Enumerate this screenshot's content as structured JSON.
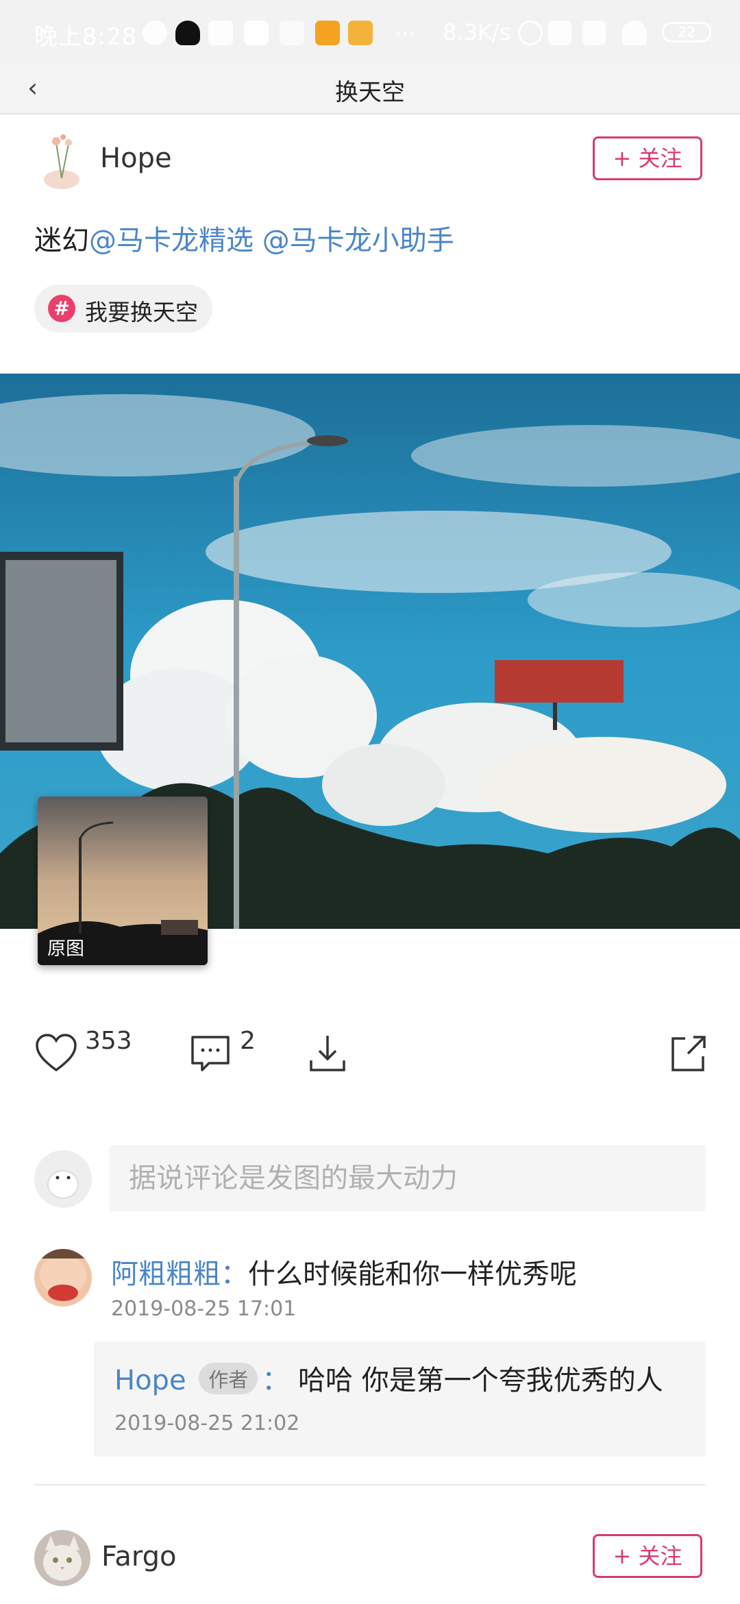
{
  "status_bar": {
    "time": "晚上8:28",
    "speed": "8.3K/s",
    "battery": "22"
  },
  "nav": {
    "back_glyph": "‹",
    "title": "换天空"
  },
  "post": {
    "author": "Hope",
    "follow_label": "+ 关注",
    "text_prefix": "迷幻",
    "mention1": "@马卡龙精选",
    "mention2": "@马卡龙小助手",
    "tag_label": "我要换天空",
    "tag_icon": "#",
    "original_label": "原图",
    "likes": "353",
    "comments": "2"
  },
  "comment_input": {
    "placeholder": "据说评论是发图的最大动力"
  },
  "comments": [
    {
      "name": "阿粗粗粗",
      "separator": "：",
      "text": "什么时候能和你一样优秀呢",
      "time": "2019-08-25  17:01",
      "reply": {
        "name": "Hope",
        "badge": "作者",
        "separator": "：",
        "text": "哈哈   你是第一个夸我优秀的人",
        "time": "2019-08-25  21:02"
      }
    }
  ],
  "next_post": {
    "author": "Fargo",
    "follow_label": "+ 关注"
  },
  "colors": {
    "accent_pink": "#d83a75",
    "mention_blue": "#4a86c8",
    "tag_red": "#ea3f6c"
  },
  "icons": [
    "heart-icon",
    "comment-icon",
    "download-icon",
    "share-icon",
    "back-icon",
    "hashtag-icon"
  ]
}
